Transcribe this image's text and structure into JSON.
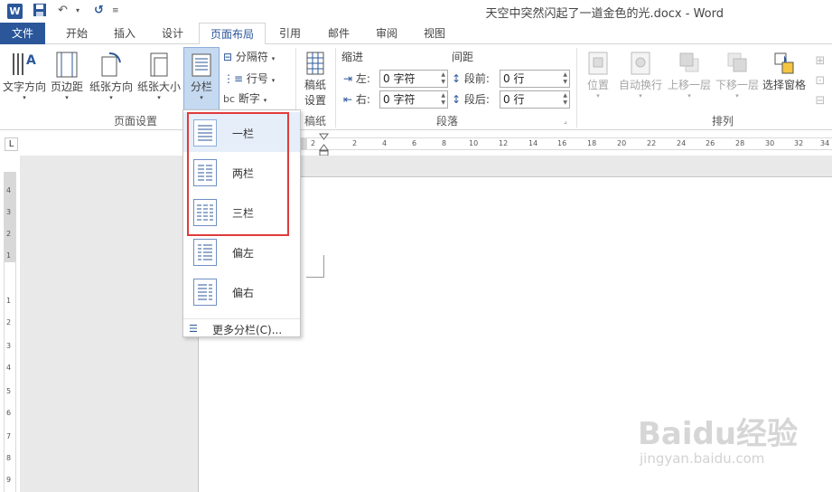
{
  "window": {
    "title": "天空中突然闪起了一道金色的光.docx - Word",
    "app_icon_letter": "W"
  },
  "tabs": [
    {
      "label": "文件"
    },
    {
      "label": "开始"
    },
    {
      "label": "插入"
    },
    {
      "label": "设计"
    },
    {
      "label": "页面布局"
    },
    {
      "label": "引用"
    },
    {
      "label": "邮件"
    },
    {
      "label": "审阅"
    },
    {
      "label": "视图"
    }
  ],
  "ribbon": {
    "page_setup": {
      "label": "页面设置",
      "text_direction": "文字方向",
      "margins": "页边距",
      "orientation": "纸张方向",
      "size": "纸张大小",
      "columns": "分栏",
      "breaks": "分隔符",
      "line_numbers": "行号",
      "hyphenation": "断字"
    },
    "manuscript": {
      "label": "稿纸",
      "button_line1": "稿纸",
      "button_line2": "设置"
    },
    "paragraph": {
      "label": "段落",
      "indent": "缩进",
      "spacing": "间距",
      "left": "左:",
      "right": "右:",
      "before": "段前:",
      "after": "段后:",
      "left_value": "0 字符",
      "right_value": "0 字符",
      "before_value": "0 行",
      "after_value": "0 行"
    },
    "arrange": {
      "label": "排列",
      "position": "位置",
      "wrap": "自动换行",
      "forward": "上移一层",
      "backward": "下移一层",
      "selection_pane": "选择窗格"
    }
  },
  "ruler": {
    "corner": "L",
    "ticks": [
      "2",
      "2",
      "4",
      "6",
      "8",
      "10",
      "12",
      "14",
      "16",
      "18",
      "20",
      "22",
      "24",
      "26",
      "28",
      "30",
      "32",
      "34"
    ],
    "vticks": [
      "4",
      "3",
      "2",
      "1",
      "1",
      "2",
      "3",
      "4",
      "5",
      "6",
      "7",
      "8",
      "9"
    ]
  },
  "dropdown": {
    "items": [
      {
        "label": "一栏"
      },
      {
        "label": "两栏"
      },
      {
        "label": "三栏"
      },
      {
        "label": "偏左"
      },
      {
        "label": "偏右"
      }
    ],
    "more": "更多分栏(C)..."
  },
  "watermark": {
    "logo": "Baidu经验",
    "sub": "jingyan.baidu.com"
  },
  "colors": {
    "accent": "#2b579a",
    "highlight": "#e03b3b"
  }
}
